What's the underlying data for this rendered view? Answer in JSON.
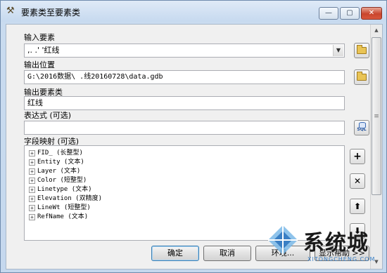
{
  "window": {
    "title": "要素类至要素类",
    "minimize_glyph": "—",
    "maximize_glyph": "▢",
    "close_glyph": "✕"
  },
  "input_features": {
    "label": "输入要素",
    "value": ",. .' '红线"
  },
  "output_location": {
    "label": "输出位置",
    "value": "G:\\2016数据\\        .线20160728\\data.gdb"
  },
  "output_feature_class": {
    "label": "输出要素类",
    "value": "红线"
  },
  "expression": {
    "label": "表达式 (可选)",
    "value": ""
  },
  "field_map": {
    "label": "字段映射 (可选)",
    "fields": [
      "FID_ (长整型)",
      "Entity (文本)",
      "Layer (文本)",
      "Color (短整型)",
      "Linetype (文本)",
      "Elevation (双精度)",
      "LineWt (短整型)",
      "RefName (文本)"
    ],
    "add_glyph": "+",
    "remove_glyph": "✕",
    "up_glyph": "⬆",
    "down_glyph": "⬇"
  },
  "icons": {
    "title_icon": "hammer-icon",
    "browse_icon": "folder-icon",
    "sql_icon": "sql-icon",
    "sql_text": "SQL"
  },
  "scrollbar": {
    "up_glyph": "▲",
    "thumb_grip": "≡",
    "down_glyph": "▼"
  },
  "buttons": {
    "ok": "确定",
    "cancel": "取消",
    "env": "环境...",
    "show_help": "显示帮助 >>"
  },
  "watermark": {
    "text": "系统城",
    "sub": "XITONGCHENG.COM",
    "colors": {
      "blue": "#3a7fc4",
      "light_blue": "#7ab8e8"
    }
  }
}
